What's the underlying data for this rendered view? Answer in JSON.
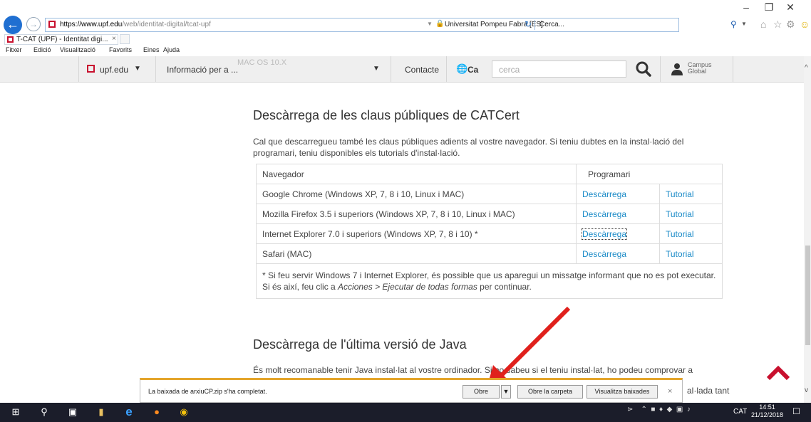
{
  "browser": {
    "url_host": "https://www.upf.edu",
    "url_path": "/web/identitat-digital/tcat-upf",
    "site_identity": "Universitat Pompeu Fabra [ES]",
    "search_placeholder": "Cerca...",
    "tab_title": "T-CAT (UPF) - Identitat digi...",
    "menu": [
      "Fitxer",
      "Edició",
      "Visualització",
      "Favorits",
      "Eines",
      "Ajuda"
    ]
  },
  "site_nav": {
    "upf_label": "upf.edu",
    "info_label": "Informació per a ...",
    "ghost_text": "MAC OS 10.X",
    "contact_label": "Contacte",
    "lang_label": "Ca",
    "search_placeholder": "cerca",
    "campus_line1": "Campus",
    "campus_line2": "Global"
  },
  "section1": {
    "title": "Descàrrega de les claus públiques de CATCert",
    "intro": "Cal que descarregueu també les claus públiques adients al vostre navegador. Si teniu dubtes en la instal·lació del programari, teniu disponibles els tutorials d'instal·lació.",
    "table": {
      "header_browser": "Navegador",
      "header_software": "Programari",
      "rows": [
        {
          "browser": "Google Chrome (Windows XP, 7, 8 i 10, Linux i MAC)",
          "download": "Descàrrega",
          "tutorial": "Tutorial"
        },
        {
          "browser": "Mozilla Firefox 3.5 i superiors (Windows XP, 7, 8 i 10, Linux i MAC)",
          "download": "Descàrrega",
          "tutorial": "Tutorial"
        },
        {
          "browser": "Internet Explorer 7.0 i superiors (Windows XP, 7, 8 i 10) *",
          "download": "Descàrrega",
          "tutorial": "Tutorial"
        },
        {
          "browser": "Safari (MAC)",
          "download": "Descàrrega",
          "tutorial": "Tutorial"
        }
      ],
      "note_prefix": "* Si feu servir Windows 7 i Internet Explorer, és possible que us aparegui un missatge informant que no es pot executar. Si és així, feu clic a ",
      "note_em": "Acciones > Ejecutar de todas formas",
      "note_suffix": " per continuar."
    }
  },
  "section2": {
    "title": "Descàrrega de l'última versió de Java",
    "text": "És molt recomanable tenir Java instal·lat al vostre ordinador. Si no sabeu si el teniu instal·lat, ho podeu comprovar a",
    "text_tail": "al·lada tant"
  },
  "download_bar": {
    "message": "La baixada de arxiuCP.zip s'ha completat.",
    "open_label": "Obre",
    "open_folder_label": "Obre la carpeta",
    "view_downloads_label": "Visualitza baixades"
  },
  "taskbar": {
    "language": "CAT",
    "time": "14:51",
    "date": "21/12/2018"
  },
  "colors": {
    "accent_red": "#c8102e",
    "link_blue": "#1a8ac7",
    "annotation_arrow": "#e0201c",
    "download_bar_border": "#e4a52b"
  }
}
